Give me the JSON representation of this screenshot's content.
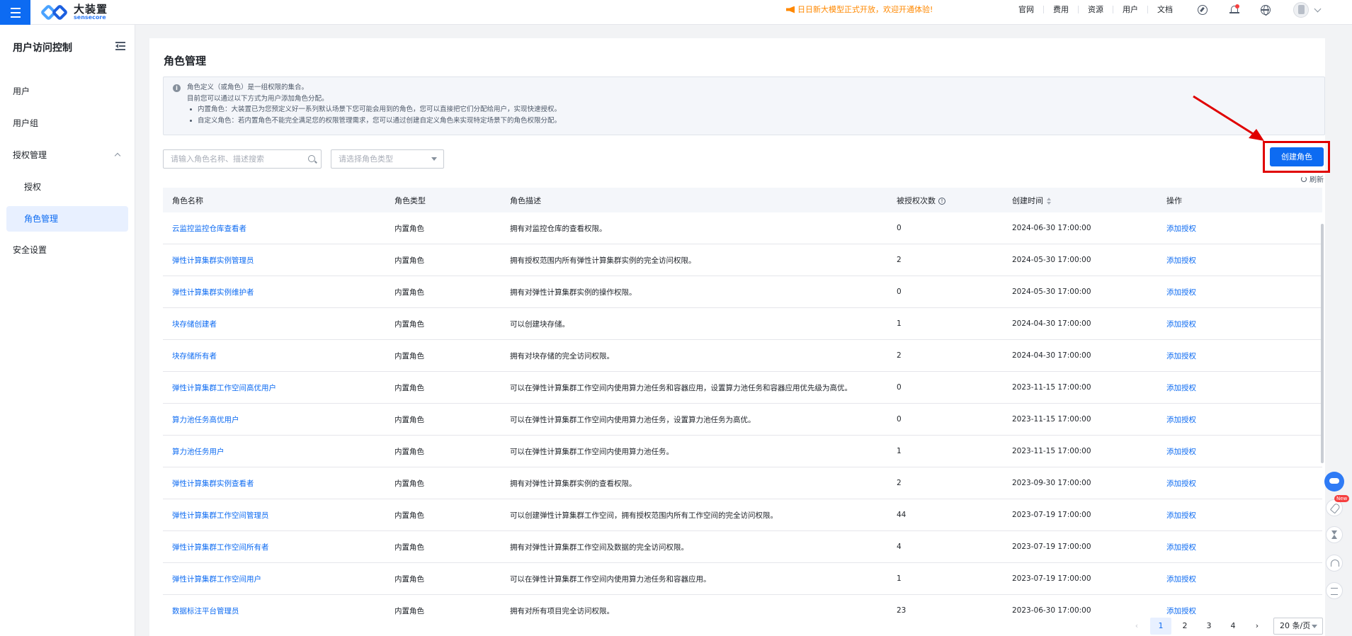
{
  "brand": {
    "name_cn": "大装置",
    "name_en": "sensecore"
  },
  "announcement": "日日新大模型正式开放，欢迎开通体验!",
  "top_nav": [
    "官网",
    "费用",
    "资源",
    "用户",
    "文档"
  ],
  "sidebar": {
    "title": "用户访问控制",
    "items": [
      {
        "label": "用户"
      },
      {
        "label": "用户组"
      },
      {
        "label": "授权管理"
      },
      {
        "label": "授权"
      },
      {
        "label": "角色管理"
      },
      {
        "label": "安全设置"
      }
    ]
  },
  "page": {
    "title": "角色管理",
    "info": {
      "line1": "角色定义（或角色）是一组权限的集合。",
      "line2": "目前您可以通过以下方式为用户添加角色分配。",
      "bullet1": "内置角色：大装置已为您预定义好一系列默认场景下您可能会用到的角色，您可以直接把它们分配给用户，实现快速授权。",
      "bullet2": "自定义角色：若内置角色不能完全满足您的权限管理需求，您可以通过创建自定义角色来实现特定场景下的角色权限分配。"
    },
    "search_placeholder": "请输入角色名称、描述搜索",
    "type_select_placeholder": "请选择角色类型",
    "create_button": "创建角色",
    "refresh_label": "刷新"
  },
  "table": {
    "headers": [
      "角色名称",
      "角色类型",
      "角色描述",
      "被授权次数",
      "创建时间",
      "操作"
    ],
    "rows": [
      {
        "name": "云监控监控仓库查看者",
        "type": "内置角色",
        "desc": "拥有对监控仓库的查看权限。",
        "count": "0",
        "created": "2024-06-30 17:00:00",
        "action": "添加授权"
      },
      {
        "name": "弹性计算集群实例管理员",
        "type": "内置角色",
        "desc": "拥有授权范围内所有弹性计算集群实例的完全访问权限。",
        "count": "2",
        "created": "2024-05-30 17:00:00",
        "action": "添加授权"
      },
      {
        "name": "弹性计算集群实例维护者",
        "type": "内置角色",
        "desc": "拥有对弹性计算集群实例的操作权限。",
        "count": "0",
        "created": "2024-05-30 17:00:00",
        "action": "添加授权"
      },
      {
        "name": "块存储创建者",
        "type": "内置角色",
        "desc": "可以创建块存储。",
        "count": "1",
        "created": "2024-04-30 17:00:00",
        "action": "添加授权"
      },
      {
        "name": "块存储所有者",
        "type": "内置角色",
        "desc": "拥有对块存储的完全访问权限。",
        "count": "2",
        "created": "2024-04-30 17:00:00",
        "action": "添加授权"
      },
      {
        "name": "弹性计算集群工作空间高优用户",
        "type": "内置角色",
        "desc": "可以在弹性计算集群工作空间内使用算力池任务和容器应用，设置算力池任务和容器应用优先级为高优。",
        "count": "0",
        "created": "2023-11-15 17:00:00",
        "action": "添加授权"
      },
      {
        "name": "算力池任务高优用户",
        "type": "内置角色",
        "desc": "可以在弹性计算集群工作空间内使用算力池任务，设置算力池任务为高优。",
        "count": "0",
        "created": "2023-11-15 17:00:00",
        "action": "添加授权"
      },
      {
        "name": "算力池任务用户",
        "type": "内置角色",
        "desc": "可以在弹性计算集群工作空间内使用算力池任务。",
        "count": "1",
        "created": "2023-11-15 17:00:00",
        "action": "添加授权"
      },
      {
        "name": "弹性计算集群实例查看者",
        "type": "内置角色",
        "desc": "拥有对弹性计算集群实例的查看权限。",
        "count": "2",
        "created": "2023-09-30 17:00:00",
        "action": "添加授权"
      },
      {
        "name": "弹性计算集群工作空间管理员",
        "type": "内置角色",
        "desc": "可以创建弹性计算集群工作空间，拥有授权范围内所有工作空间的完全访问权限。",
        "count": "44",
        "created": "2023-07-19 17:00:00",
        "action": "添加授权"
      },
      {
        "name": "弹性计算集群工作空间所有者",
        "type": "内置角色",
        "desc": "拥有对弹性计算集群工作空间及数据的完全访问权限。",
        "count": "4",
        "created": "2023-07-19 17:00:00",
        "action": "添加授权"
      },
      {
        "name": "弹性计算集群工作空间用户",
        "type": "内置角色",
        "desc": "可以在弹性计算集群工作空间内使用算力池任务和容器应用。",
        "count": "1",
        "created": "2023-07-19 17:00:00",
        "action": "添加授权"
      },
      {
        "name": "数据标注平台管理员",
        "type": "内置角色",
        "desc": "拥有对所有项目完全访问权限。",
        "count": "23",
        "created": "2023-06-30 17:00:00",
        "action": "添加授权"
      }
    ]
  },
  "pagination": {
    "prev": "‹",
    "pages": [
      "1",
      "2",
      "3",
      "4"
    ],
    "next": "›",
    "page_size": "20 条/页"
  },
  "float_tools": {
    "new_badge": "New"
  },
  "colors": {
    "primary": "#0d6bf2",
    "announce": "#ff8800",
    "highlight": "#e00000"
  }
}
